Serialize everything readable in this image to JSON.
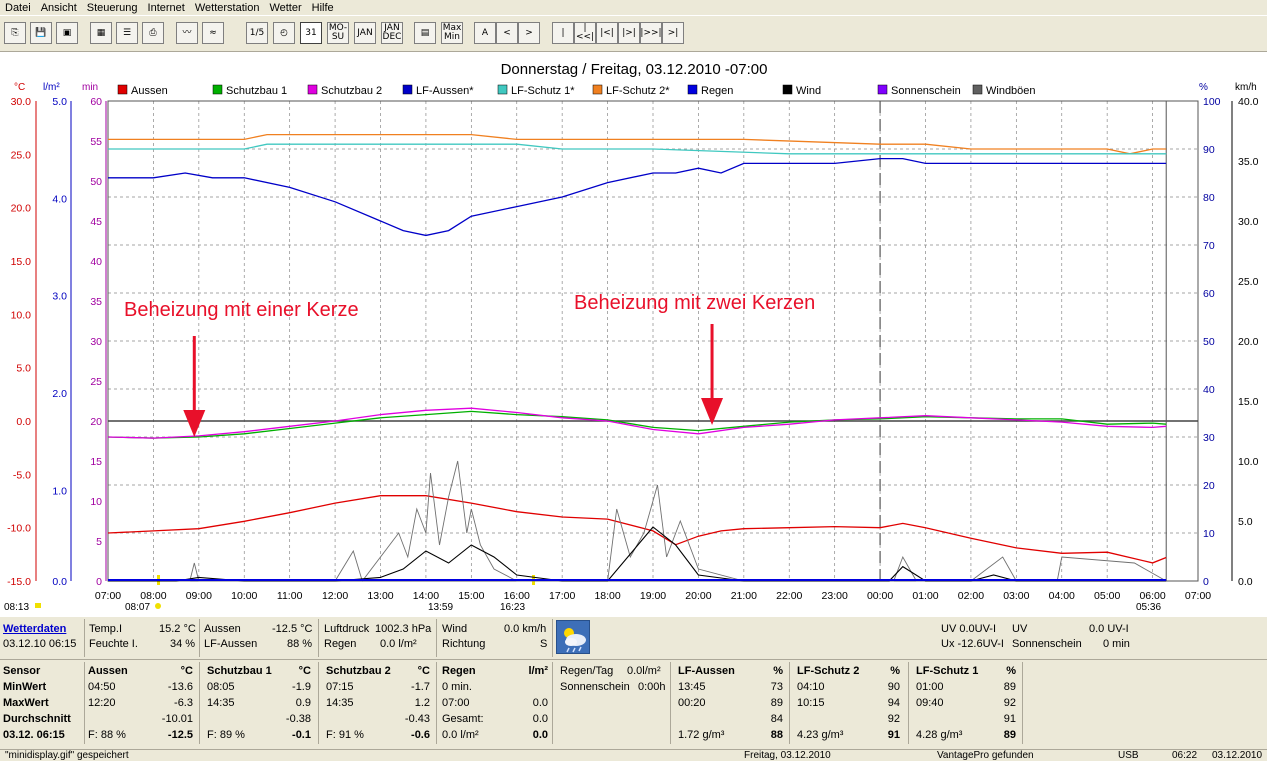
{
  "menu": [
    "Datei",
    "Ansicht",
    "Steuerung",
    "Internet",
    "Wetterstation",
    "Wetter",
    "Hilfe"
  ],
  "toolbar": {
    "icons": [
      "bulletin-icon",
      "save-icon",
      "save-disabled-icon",
      "summary-icon",
      "report-icon",
      "print-icon",
      "graph-icon",
      "strip-chart-icon"
    ],
    "period_buttons": [
      "1/5",
      "◴",
      "31",
      "MO-SU",
      "JAN",
      "JAN DEC"
    ],
    "view_buttons": [
      "▤",
      "Max Min"
    ],
    "nav_buttons": [
      "A",
      "<",
      ">",
      "|",
      "|<<|",
      "|<|",
      "|>|",
      "|>>|",
      ">|"
    ]
  },
  "chart_data": {
    "type": "line",
    "title": "Donnerstag / Freitag, 03.12.2010  -07:00",
    "legend": [
      {
        "name": "Aussen",
        "color": "#e00000"
      },
      {
        "name": "Schutzbau 1",
        "color": "#00b000"
      },
      {
        "name": "Schutzbau 2",
        "color": "#e000e0"
      },
      {
        "name": "LF-Aussen*",
        "color": "#0000c8"
      },
      {
        "name": "LF-Schutz 1*",
        "color": "#40c8c0"
      },
      {
        "name": "LF-Schutz 2*",
        "color": "#f08020"
      },
      {
        "name": "Regen",
        "color": "#0000e0"
      },
      {
        "name": "Wind",
        "color": "#000000"
      },
      {
        "name": "Sonnenschein",
        "color": "#8000ff"
      },
      {
        "name": "Windböen",
        "color": "#606060"
      }
    ],
    "axes": {
      "temp_unit": "°C",
      "rain_unit": "l/m²",
      "min_unit": "min",
      "pct_unit": "%",
      "kmh_unit": "km/h",
      "temp_ticks": [
        "30.0",
        "25.0",
        "20.0",
        "15.0",
        "10.0",
        "5.0",
        "0.0",
        "-5.0",
        "-10.0",
        "-15.0"
      ],
      "rain_ticks": [
        "5.0",
        "4.0",
        "3.0",
        "2.0",
        "1.0",
        "0.0"
      ],
      "min_ticks": [
        "60",
        "55",
        "50",
        "45",
        "40",
        "35",
        "30",
        "25",
        "20",
        "15",
        "10",
        "5",
        "0"
      ],
      "pct_ticks": [
        "100",
        "90",
        "80",
        "70",
        "60",
        "50",
        "40",
        "30",
        "20",
        "10",
        "0"
      ],
      "kmh_ticks": [
        "40.0",
        "35.0",
        "30.0",
        "25.0",
        "20.0",
        "15.0",
        "10.0",
        "5.0",
        "0.0"
      ],
      "x_ticks": [
        "07:00",
        "08:00",
        "09:00",
        "10:00",
        "11:00",
        "12:00",
        "13:00",
        "14:00",
        "15:00",
        "16:00",
        "17:00",
        "18:00",
        "19:00",
        "20:00",
        "21:00",
        "22:00",
        "23:00",
        "00:00",
        "01:00",
        "02:00",
        "03:00",
        "04:00",
        "05:00",
        "06:00",
        "07:00"
      ],
      "x_range_hours": [
        0,
        24
      ],
      "temp_range": [
        -15,
        30
      ],
      "pct_range": [
        0,
        100
      ],
      "kmh_range": [
        0,
        40
      ],
      "midnight_hour": 17,
      "now_hour": 23.3
    },
    "sun_markers": {
      "sunrise_above": "08:13",
      "sunrise": "08:07",
      "mid": "13:59",
      "sunset": "16:23",
      "rise_next": "05:36"
    },
    "annotations": [
      {
        "text": "Beheizung mit einer Kerze",
        "arrow_hour": 1.9,
        "color": "#e8102a"
      },
      {
        "text": "Beheizung mit zwei Kerzen",
        "arrow_hour": 13.3,
        "color": "#e8102a"
      }
    ],
    "series": [
      {
        "name": "LF-Schutz 2*",
        "axis": "pct",
        "x": [
          0,
          3,
          3.5,
          8,
          9,
          10,
          11,
          12,
          14,
          17,
          18,
          19,
          21,
          22,
          22.5,
          23,
          23.3
        ],
        "values": [
          92,
          92,
          93,
          93,
          92,
          92,
          92,
          92,
          92,
          91,
          91,
          90,
          90,
          90,
          89,
          90,
          90
        ]
      },
      {
        "name": "LF-Schutz 1*",
        "axis": "pct",
        "x": [
          0,
          3,
          3.5,
          8,
          9,
          10,
          12,
          15,
          16,
          17,
          18,
          19,
          21,
          23.3
        ],
        "values": [
          90,
          90,
          91,
          91,
          91,
          90,
          90,
          89,
          89,
          89,
          89,
          89,
          89,
          89
        ]
      },
      {
        "name": "LF-Aussen*",
        "axis": "pct",
        "x": [
          0,
          1,
          1.7,
          2.3,
          3,
          4,
          5,
          6,
          6.5,
          7,
          7.5,
          8,
          9,
          10,
          11,
          12,
          12.5,
          13,
          13.5,
          14,
          14.5,
          15,
          16,
          17,
          17.5,
          18,
          19,
          20,
          21,
          22,
          23.3
        ],
        "values": [
          84,
          84,
          85,
          84,
          84,
          82,
          79,
          75,
          73,
          72,
          73,
          76,
          78,
          80,
          83,
          85,
          85,
          86,
          85,
          87,
          87,
          87,
          87,
          88,
          88,
          87,
          87,
          87,
          87,
          87,
          87
        ]
      },
      {
        "name": "Aussen",
        "axis": "temp",
        "x": [
          0,
          1,
          2,
          3,
          4,
          5,
          6,
          7,
          8,
          9,
          10,
          11,
          12,
          12.5,
          13,
          13.5,
          14,
          15,
          16,
          17,
          17.5,
          18,
          19,
          20,
          21,
          22,
          23,
          23.3
        ],
        "values": [
          -10.5,
          -10.3,
          -10.1,
          -9.4,
          -8.6,
          -7.7,
          -7.0,
          -7.0,
          -7.7,
          -8.5,
          -9.0,
          -9.2,
          -10.3,
          -11.6,
          -10.8,
          -10.3,
          -10.1,
          -10.0,
          -9.9,
          -10.0,
          -9.6,
          -10.0,
          -11.0,
          -11.9,
          -12.4,
          -12.3,
          -13.3,
          -12.8
        ]
      },
      {
        "name": "Schutzbau 1",
        "axis": "temp",
        "x": [
          0,
          1,
          2,
          3,
          4,
          5,
          6,
          7,
          8,
          9,
          10,
          11,
          12,
          13,
          14,
          15,
          16,
          17,
          18,
          19,
          20,
          21,
          22,
          23,
          23.3
        ],
        "values": [
          -1.5,
          -1.6,
          -1.5,
          -1.2,
          -0.7,
          -0.2,
          0.3,
          0.6,
          0.9,
          0.6,
          0.4,
          0.1,
          -0.6,
          -0.9,
          -0.5,
          -0.1,
          0.1,
          0.2,
          0.4,
          0.3,
          0.2,
          0.2,
          -0.3,
          -0.2,
          -0.3
        ]
      },
      {
        "name": "Schutzbau 2",
        "axis": "temp",
        "x": [
          0,
          1,
          2,
          3,
          4,
          5,
          6,
          7,
          8,
          9,
          10,
          11,
          12,
          13,
          14,
          15,
          16,
          17,
          18,
          19,
          20,
          21,
          22,
          23,
          23.3
        ],
        "values": [
          -1.5,
          -1.6,
          -1.4,
          -1.0,
          -0.5,
          0.0,
          0.6,
          1.0,
          1.2,
          0.8,
          0.3,
          0.0,
          -0.8,
          -1.2,
          -0.6,
          -0.3,
          0.1,
          0.3,
          0.5,
          0.3,
          0.1,
          -0.1,
          -0.5,
          -0.6,
          -0.5
        ]
      }
    ],
    "wind_kmh": {
      "x": [
        0,
        1,
        1.5,
        2,
        3,
        4,
        5,
        6,
        6.5,
        7,
        7.5,
        8,
        8.5,
        9,
        10,
        11,
        12,
        12.5,
        13,
        14,
        15,
        17.2,
        17.5,
        18,
        19,
        19.5,
        20,
        21,
        22,
        23.3
      ],
      "values": [
        0,
        0,
        0,
        0.3,
        0,
        0,
        0,
        0.3,
        1,
        2.5,
        1.5,
        3,
        2,
        0.5,
        0,
        0,
        4.5,
        3,
        0.5,
        0,
        0,
        0,
        1.2,
        0,
        0,
        0.5,
        0,
        0,
        0,
        0
      ]
    },
    "gust_kmh": {
      "x": [
        0,
        1.8,
        1.9,
        2,
        3,
        5,
        5.4,
        5.6,
        6.4,
        6.6,
        6.8,
        7.0,
        7.1,
        7.3,
        7.5,
        7.7,
        7.9,
        8.0,
        8.2,
        8.5,
        9,
        9.5,
        10,
        11,
        11.2,
        11.5,
        11.8,
        12.1,
        12.3,
        12.6,
        13,
        14,
        15,
        17.3,
        17.5,
        17.8,
        18,
        19,
        19.7,
        20,
        20.9,
        21,
        22.6,
        23.3
      ],
      "values": [
        0,
        0,
        1.5,
        0,
        0,
        0,
        2.5,
        0,
        4,
        2,
        6,
        4,
        9,
        3,
        7,
        10,
        4,
        6,
        3,
        1,
        0,
        0,
        0,
        0,
        6,
        2,
        4,
        8,
        2,
        5,
        1,
        0,
        0,
        0,
        2,
        0,
        0,
        0,
        2,
        0,
        0,
        2,
        1.5,
        0
      ]
    },
    "sun_bar_hours": [
      1,
      9.5
    ]
  },
  "info": {
    "wetterdaten_link": "Wetterdaten",
    "datetime": "03.12.10 06:15",
    "temp_i_label": "Temp.I",
    "temp_i": "15.2 °C",
    "feuchte_i_label": "Feuchte I.",
    "feuchte_i": "34 %",
    "aussen_label": "Aussen",
    "aussen": "-12.5 °C",
    "lf_aussen_label": "LF-Aussen",
    "lf_aussen": "88 %",
    "luftdruck_label": "Luftdruck",
    "luftdruck": "1002.3 hPa",
    "regen_label": "Regen",
    "regen": "0.0 l/m²",
    "wind_label": "Wind",
    "wind": "0.0 km/h",
    "richtung_label": "Richtung",
    "richtung": "S",
    "uv1": "UV 0.0UV-I",
    "uv_label": "UV",
    "uv2": "0.0 UV-I",
    "ux1": "Ux -12.6UV-I",
    "sonnenschein_label": "Sonnenschein",
    "sonnenschein": "0 min",
    "table": {
      "row_labels": [
        "Sensor",
        "MinWert",
        "MaxWert",
        "Durchschnitt",
        "03.12. 06:15"
      ],
      "aussen": {
        "header": "Aussen",
        "unit": "°C",
        "min_t": "04:50",
        "min": "-13.6",
        "max_t": "12:20",
        "max": "-6.3",
        "avg": "-10.01",
        "cur_f": "F: 88 %",
        "cur": "-12.5"
      },
      "schutz1": {
        "header": "Schutzbau 1",
        "unit": "°C",
        "min_t": "08:05",
        "min": "-1.9",
        "max_t": "14:35",
        "max": "0.9",
        "avg": "-0.38",
        "cur_f": "F: 89 %",
        "cur": "-0.1"
      },
      "schutz2": {
        "header": "Schutzbau 2",
        "unit": "°C",
        "min_t": "07:15",
        "min": "-1.7",
        "max_t": "14:35",
        "max": "1.2",
        "avg": "-0.43",
        "cur_f": "F: 91 %",
        "cur": "-0.6"
      },
      "regen": {
        "header": "Regen",
        "unit": "l/m²",
        "min_t": "0 min.",
        "max_t": "07:00",
        "max": "0.0",
        "gesamt_label": "Gesamt:",
        "gesamt": "0.0",
        "cur_f": "0.0 l/m²",
        "cur": "0.0"
      },
      "regen_tag": {
        "label1": "Regen/Tag",
        "value1": "0.0l/m²",
        "label2": "Sonnenschein",
        "value2": "0:00h"
      },
      "lf_aussen": {
        "header": "LF-Aussen",
        "unit": "%",
        "min_t": "13:45",
        "min": "73",
        "max_t": "00:20",
        "max": "89",
        "avg": "84",
        "cur_f": "1.72 g/m³",
        "cur": "88"
      },
      "lf_schutz2": {
        "header": "LF-Schutz 2",
        "unit": "%",
        "min_t": "04:10",
        "min": "90",
        "max_t": "10:15",
        "max": "94",
        "avg": "92",
        "cur_f": "4.23 g/m³",
        "cur": "91"
      },
      "lf_schutz1": {
        "header": "LF-Schutz 1",
        "unit": "%",
        "min_t": "01:00",
        "min": "89",
        "max_t": "09:40",
        "max": "92",
        "avg": "91",
        "cur_f": "4.28 g/m³",
        "cur": "89"
      }
    }
  },
  "status": {
    "msg": "\"minidisplay.gif\" gespeichert",
    "date": "Freitag, 03.12.2010",
    "station": "VantagePro gefunden",
    "port": "USB",
    "time": "06:22",
    "date2": "03.12.2010"
  }
}
